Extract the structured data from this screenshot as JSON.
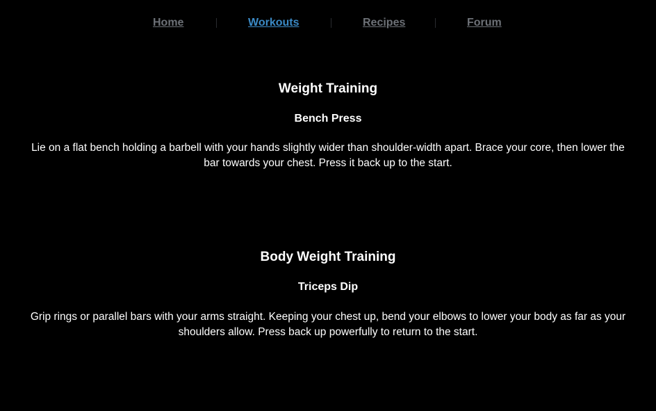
{
  "nav": {
    "items": [
      {
        "label": "Home",
        "active": false
      },
      {
        "label": "Workouts",
        "active": true
      },
      {
        "label": "Recipes",
        "active": false
      },
      {
        "label": "Forum",
        "active": false
      }
    ]
  },
  "sections": [
    {
      "title": "Weight Training",
      "exercise": {
        "name": "Bench Press",
        "description": "Lie on a flat bench holding a barbell with your hands slightly wider than shoulder-width apart. Brace your core, then lower the bar towards your chest. Press it back up to the start."
      }
    },
    {
      "title": "Body Weight Training",
      "exercise": {
        "name": "Triceps Dip",
        "description": "Grip rings or parallel bars with your arms straight. Keeping your chest up, bend your elbows to lower your body as far as your shoulders allow. Press back up powerfully to return to the start."
      }
    }
  ],
  "colors": {
    "background": "#000000",
    "text": "#ffffff",
    "nav_inactive": "#6d7177",
    "nav_active": "#3b8ac6"
  }
}
